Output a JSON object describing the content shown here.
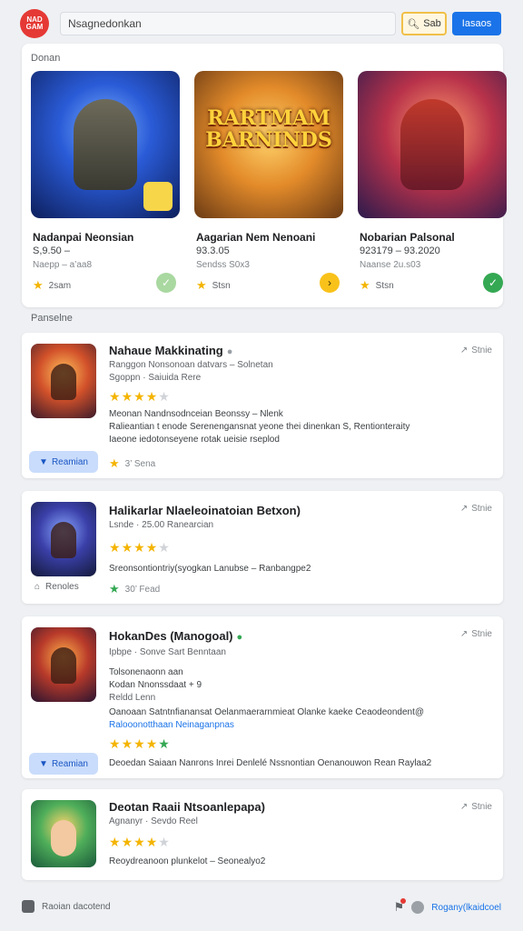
{
  "header": {
    "logo_text": "NAD\nGAM",
    "search_value": "Nsagnedonkan",
    "search_button_label": "Sab",
    "primary_button_label": "Iasaos"
  },
  "featured": {
    "section_label": "Donan",
    "cards": [
      {
        "title": "Nadanpai Neonsian",
        "sub": "S,9.50 –",
        "meta": "Naepp – a’aa8",
        "rating": "2sam",
        "art_text": ""
      },
      {
        "title": "Aagarian Nem Nenoani",
        "sub": "93.3.05",
        "meta": "Sendss  S0x3",
        "rating": "Stsn",
        "art_text": "RARTMAM BARNINDS"
      },
      {
        "title": "Nobarian Palsonal",
        "sub": "923179 – 93.2020",
        "meta": "Naanse  2u.s03",
        "rating": "Stsn",
        "art_text": ""
      }
    ]
  },
  "popular": {
    "section_label": "Panselne",
    "items": [
      {
        "title": "Nahaue Makkinating",
        "line1": "Ranggon Nonsonoan  datvars – Solnetan",
        "line2": "Sgoppn · Saiuida   Rere",
        "line3": "Meonan Nandnsodnceian Beonssy – Nlenk",
        "line4": "Ralieantian t enode Serenengansnat yeone thei dinenkan S,  Rentionteraity",
        "line5": "Iaeone iedotonseyene rotak ueisie rseplod",
        "share": "Stnie",
        "install": "Reamian",
        "foot": "3’   Sena"
      },
      {
        "title": "Halikarlar Nlaeleoinatoian Betxon)",
        "line1": "Lsnde · 25.00   Ranearcian",
        "line2": "Sreonsontiontriy(syogkan  Lanubse – Ranbangpe2",
        "share": "Stnie",
        "ghost": "Renoles",
        "foot": "30’   Fead"
      },
      {
        "title": "HokanDes (Manogoal)",
        "line1": "Ipbpe · Sonve   Sart Benntaan",
        "line2": "Tolsonenaonn  aan",
        "line3": "Kodan Nnonssdaat + 9",
        "line4": "Reldd  Lenn",
        "line5": "Oanoaan  Satntnfianansat Oelanmaerarnmieat  Olanke kaeke Ceaodeondent@",
        "line6": "Ralooonotthaan  Neinaganpnas",
        "bottom_line": "Deoedan Saiaan Nanrons   Inrei Denlelé Nssnontian  Oenanouwon  Rean Raylaa2",
        "share": "Stnie",
        "install": "Reamian"
      },
      {
        "title": "Deotan Raaii Ntsoanlepapa)",
        "line1": "Agnanyr · Sevdo   Reel",
        "line2": "Reoydreanoon  plunkelot – Seonealyo2",
        "share": "Stnie"
      }
    ]
  },
  "footer": {
    "left_label": "Raoian dacotend",
    "right_label": "Rogany(lkaidcoel"
  },
  "colors": {
    "accent": "#1a73e8",
    "brand": "#e53935",
    "star": "#f4b400",
    "success": "#34a853"
  }
}
